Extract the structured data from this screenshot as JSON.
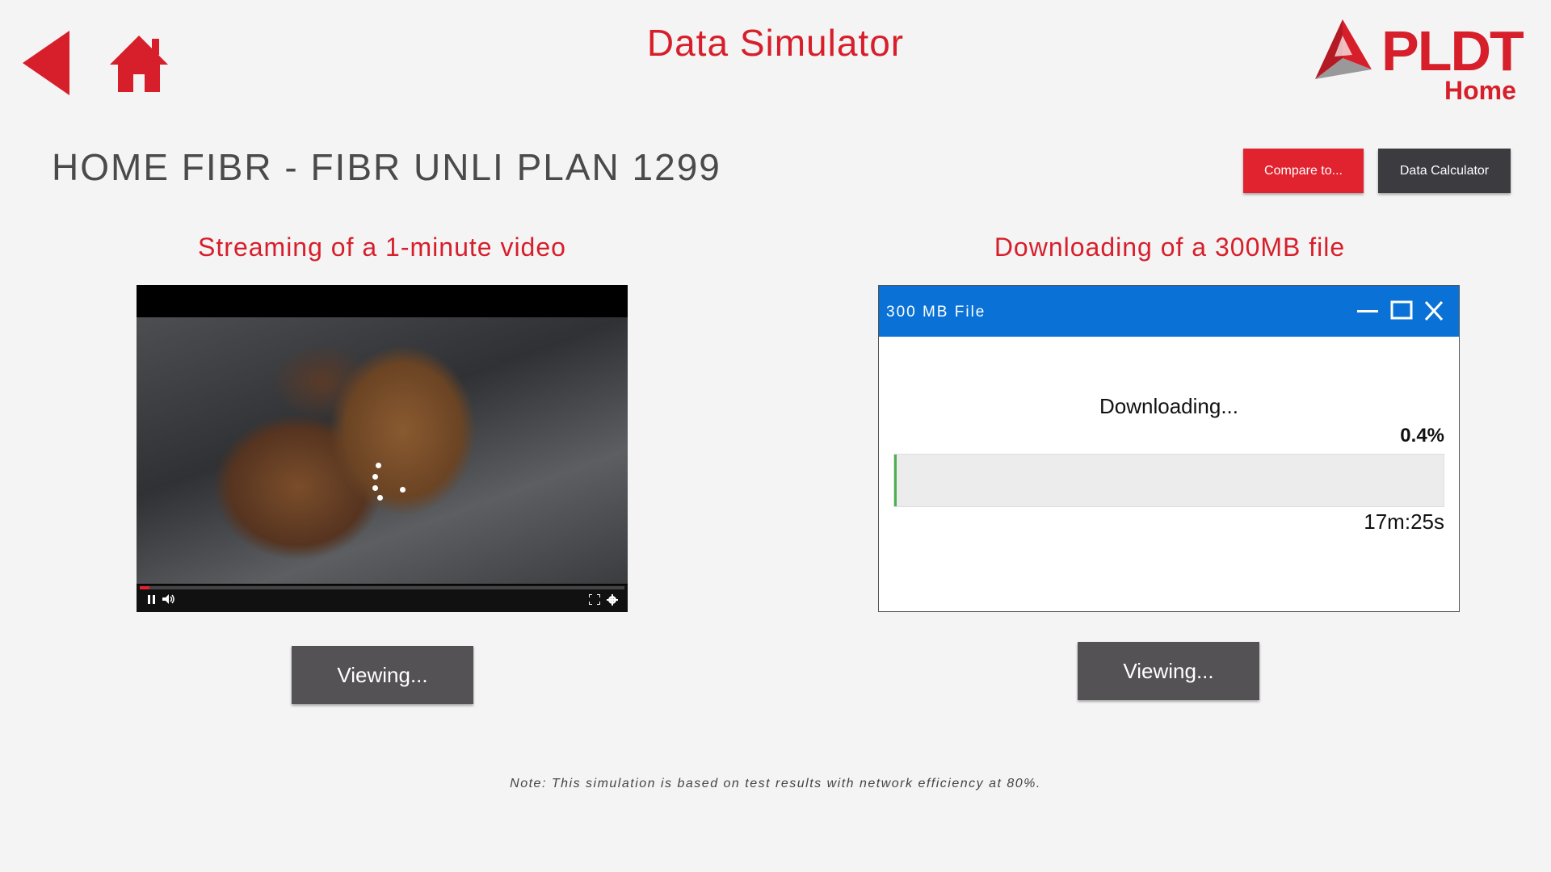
{
  "app": {
    "title": "Data Simulator"
  },
  "nav": {
    "back_icon": "back-arrow-icon",
    "home_icon": "home-icon"
  },
  "logo": {
    "brand": "PLDT",
    "sub": "Home"
  },
  "plan": {
    "title": "HOME FIBR - FIBR UNLI PLAN 1299"
  },
  "toolbar": {
    "compare_label": "Compare to...",
    "calculator_label": "Data Calculator"
  },
  "streaming": {
    "title": "Streaming of a 1-minute video",
    "progress": 0.02,
    "controls": {
      "pause_icon": "pause-icon",
      "volume_icon": "volume-icon",
      "fullscreen_icon": "fullscreen-icon",
      "settings_icon": "gear-icon"
    },
    "button_label": "Viewing..."
  },
  "download": {
    "title": "Downloading of a 300MB file",
    "window_title": "300 MB File",
    "status": "Downloading...",
    "percent": "0.4%",
    "progress": 0.004,
    "time_left": "17m:25s",
    "button_label": "Viewing..."
  },
  "note": "Note: This simulation is based on test results with network efficiency at 80%.",
  "colors": {
    "accent": "#d71f2b",
    "button_dark": "#3c3c40",
    "titlebar": "#0a72d6",
    "progress": "#4caf50"
  }
}
